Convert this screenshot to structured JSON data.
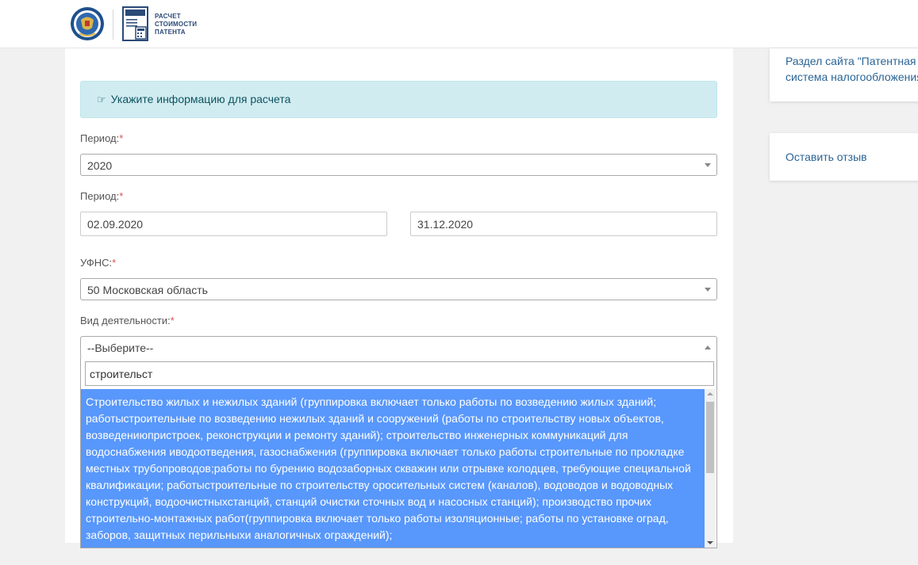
{
  "header": {
    "logo_lines": [
      "РАСЧЕТ",
      "СТОИМОСТИ",
      "ПАТЕНТА"
    ]
  },
  "form": {
    "info_text": "Укажите информацию для расчета",
    "period_label": "Период:",
    "period_value": "2020",
    "dates_label": "Период:",
    "date_from": "02.09.2020",
    "date_to": "31.12.2020",
    "ufns_label": "УФНС:",
    "ufns_value": "50 Московская область",
    "activity_label": "Вид деятельности:",
    "activity_value": "--Выберите--",
    "required_mark": "*",
    "search_text": "строительст",
    "highlighted_option": "Строительство жилых и нежилых зданий (группировка включает только работы по возведению жилых зданий; работыстроительные по возведению нежилых зданий и сооружений (работы по строительству новых объектов, возведениюпристроек, реконструкции и ремонту зданий); строительство инженерных коммуникаций для водоснабжения иводоотведения, газоснабжения (группировка включает только работы строительные по прокладке местных трубопроводов;работы по бурению водозаборных скважин или отрывке колодцев, требующие специальной квалификации; работыстроительные по строительству оросительных систем (каналов), водоводов и водоводных конструкций, водоочистныхстанций, станций очистки сточных вод и насосных станций); производство прочих строительно-монтажных работ(группировка включает только работы изоляционные; работы по установке оград, заборов, защитных перильныхи аналогичных ограждений);"
  },
  "sidebar": {
    "link1": "Раздел сайта \"Патентная система налогообложения\"",
    "link2": "Оставить отзыв"
  },
  "colors": {
    "info_bg": "#d1ecf1",
    "highlight": "#5897fb",
    "link": "#2a6496",
    "required": "#d9534f"
  }
}
